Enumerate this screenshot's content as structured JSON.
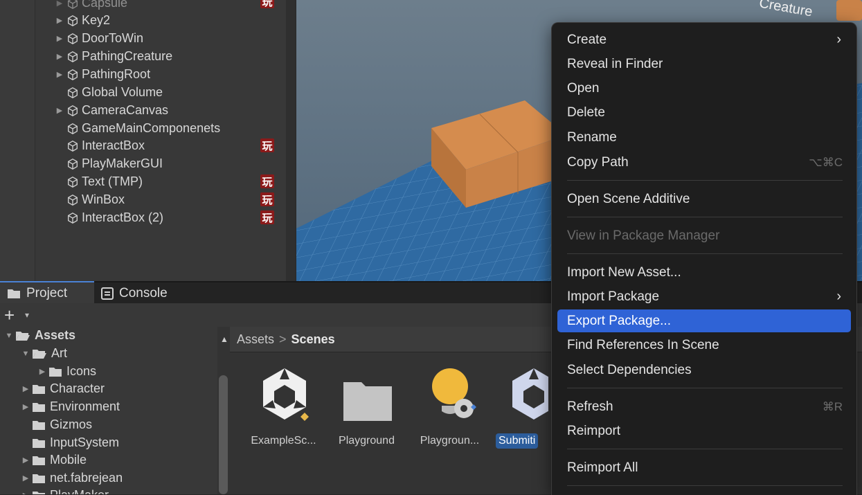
{
  "hierarchy": {
    "items": [
      {
        "label": "Capsule",
        "expandable": true,
        "badge": true
      },
      {
        "label": "Key2",
        "expandable": true,
        "badge": false
      },
      {
        "label": "DoorToWin",
        "expandable": true,
        "badge": false
      },
      {
        "label": "PathingCreature",
        "expandable": true,
        "badge": false
      },
      {
        "label": "PathingRoot",
        "expandable": true,
        "badge": false
      },
      {
        "label": "Global Volume",
        "expandable": false,
        "badge": false
      },
      {
        "label": "CameraCanvas",
        "expandable": true,
        "badge": false
      },
      {
        "label": "GameMainComponenets",
        "expandable": false,
        "badge": false
      },
      {
        "label": "InteractBox",
        "expandable": false,
        "badge": true
      },
      {
        "label": "PlayMakerGUI",
        "expandable": false,
        "badge": false
      },
      {
        "label": "Text (TMP)",
        "expandable": false,
        "badge": true
      },
      {
        "label": "WinBox",
        "expandable": false,
        "badge": true
      },
      {
        "label": "InteractBox (2)",
        "expandable": false,
        "badge": true
      }
    ],
    "badge_glyph": "玩"
  },
  "scene": {
    "label_fragment": "Creature"
  },
  "tabs": [
    {
      "label": "Project",
      "icon": "folder-icon",
      "active": true
    },
    {
      "label": "Console",
      "icon": "console-icon",
      "active": false
    }
  ],
  "toolbar": {
    "add_label": "+",
    "add_caret": "▾"
  },
  "tree": {
    "items": [
      {
        "label": "Assets",
        "bold": true,
        "open": true,
        "arrow": "▼"
      },
      {
        "label": "Art",
        "bold": false,
        "open": true,
        "arrow": "▼"
      },
      {
        "label": "Icons",
        "bold": false,
        "open": false,
        "arrow": "▶"
      },
      {
        "label": "Character",
        "bold": false,
        "open": false,
        "arrow": "▶"
      },
      {
        "label": "Environment",
        "bold": false,
        "open": false,
        "arrow": "▶"
      },
      {
        "label": "Gizmos",
        "bold": false,
        "open": false,
        "arrow": ""
      },
      {
        "label": "InputSystem",
        "bold": false,
        "open": false,
        "arrow": ""
      },
      {
        "label": "Mobile",
        "bold": false,
        "open": false,
        "arrow": "▶"
      },
      {
        "label": "net.fabrejean",
        "bold": false,
        "open": false,
        "arrow": "▶"
      },
      {
        "label": "PlayMaker",
        "bold": false,
        "open": false,
        "arrow": "▶"
      }
    ]
  },
  "breadcrumb": {
    "root": "Assets",
    "separator": ">",
    "current": "Scenes"
  },
  "assets": [
    {
      "label": "ExampleSc...",
      "kind": "unity-scene-icon"
    },
    {
      "label": "Playground",
      "kind": "folder-icon"
    },
    {
      "label": "Playgroun...",
      "kind": "lighting-settings-icon"
    },
    {
      "label": "Submiti",
      "kind": "unity-scene-icon",
      "selected": true
    }
  ],
  "context_menu": {
    "items": [
      {
        "label": "Create",
        "shortcut": "",
        "submenu": true
      },
      {
        "label": "Reveal in Finder",
        "shortcut": ""
      },
      {
        "label": "Open",
        "shortcut": ""
      },
      {
        "label": "Delete",
        "shortcut": ""
      },
      {
        "label": "Rename",
        "shortcut": ""
      },
      {
        "label": "Copy Path",
        "shortcut": "⌥⌘C"
      },
      {
        "label": "Open Scene Additive",
        "shortcut": ""
      },
      {
        "label": "View in Package Manager",
        "shortcut": "",
        "disabled": true
      },
      {
        "label": "Import New Asset...",
        "shortcut": ""
      },
      {
        "label": "Import Package",
        "shortcut": "",
        "submenu": true
      },
      {
        "label": "Export Package...",
        "shortcut": "",
        "highlighted": true
      },
      {
        "label": "Find References In Scene",
        "shortcut": ""
      },
      {
        "label": "Select Dependencies",
        "shortcut": ""
      },
      {
        "label": "Refresh",
        "shortcut": "⌘R"
      },
      {
        "label": "Reimport",
        "shortcut": ""
      },
      {
        "label": "Reimport All",
        "shortcut": ""
      }
    ],
    "submenu_glyph": "›"
  },
  "colors": {
    "accent": "#2f63d6",
    "selection": "#2c5d9c",
    "badge": "#8b1a1a",
    "box": "#c98248"
  }
}
